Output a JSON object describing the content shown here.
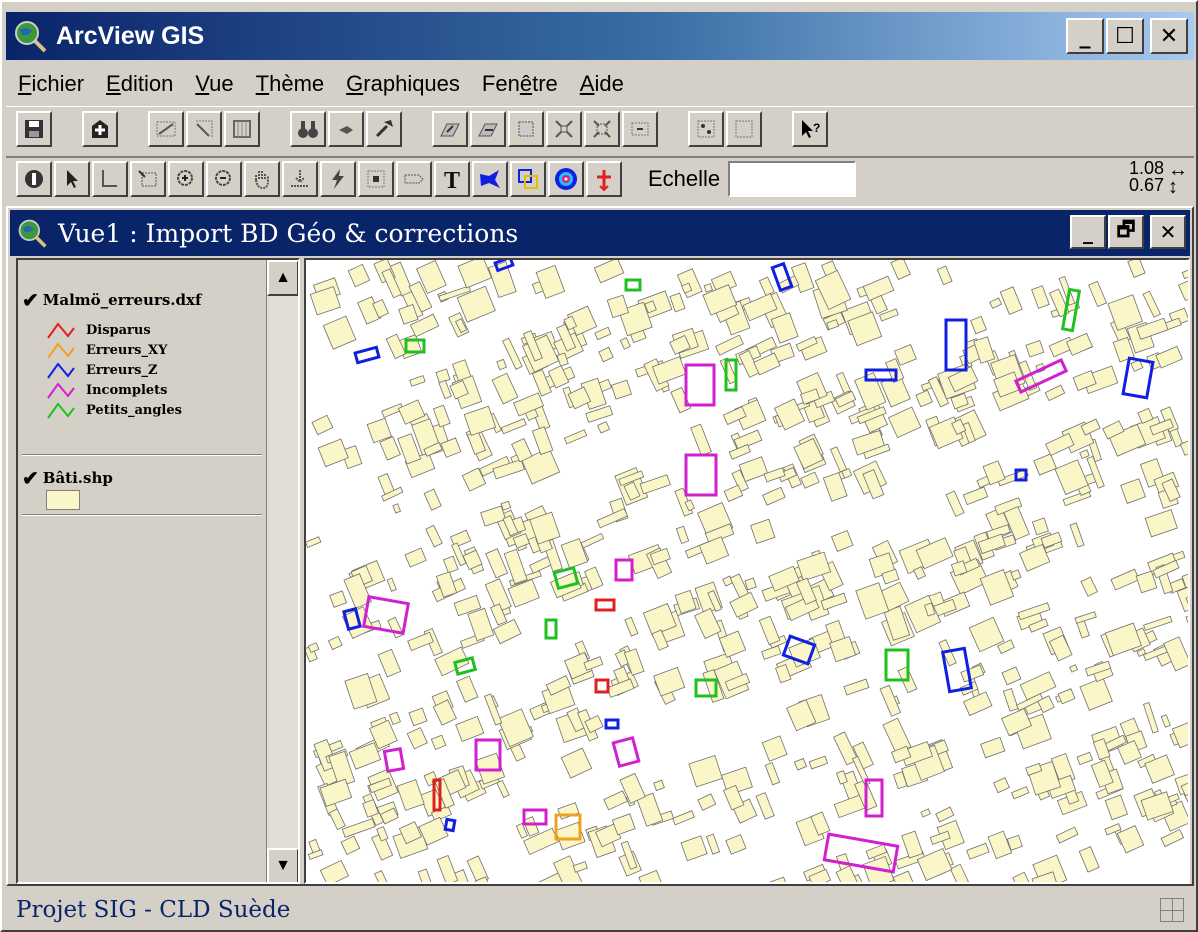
{
  "app": {
    "title": "ArcView GIS"
  },
  "menu": {
    "items": [
      {
        "ul": "F",
        "rest": "ichier"
      },
      {
        "ul": "E",
        "rest": "dition"
      },
      {
        "ul": "V",
        "rest": "ue"
      },
      {
        "ul": "T",
        "rest": "hème"
      },
      {
        "ul": "G",
        "rest": "raphiques"
      },
      {
        "pre": "Fen",
        "ul": "ê",
        "rest": "tre"
      },
      {
        "ul": "A",
        "rest": "ide"
      }
    ]
  },
  "toolbar2": {
    "scale_label": "Echelle",
    "scale_value": "",
    "coord_x": "1.08",
    "coord_y": "0.67"
  },
  "view": {
    "title": "Vue1 : Import BD Géo & corrections"
  },
  "toc": {
    "theme1": {
      "name": "Malmö_erreurs.dxf",
      "legend": [
        {
          "label": "Disparus",
          "color": "#e02020"
        },
        {
          "label": "Erreurs_XY",
          "color": "#f0a020"
        },
        {
          "label": "Erreurs_Z",
          "color": "#1020e0"
        },
        {
          "label": "Incomplets",
          "color": "#d020d0"
        },
        {
          "label": "Petits_angles",
          "color": "#20c020"
        }
      ]
    },
    "theme2": {
      "name": "Bâti.shp",
      "fill_color": "#fbf6c8"
    }
  },
  "status": {
    "text": "Projet  SIG - CLD Suède"
  },
  "colors": {
    "title_active": "#0a246a",
    "building_fill": "#fbf6c8",
    "building_stroke": "#707070"
  }
}
